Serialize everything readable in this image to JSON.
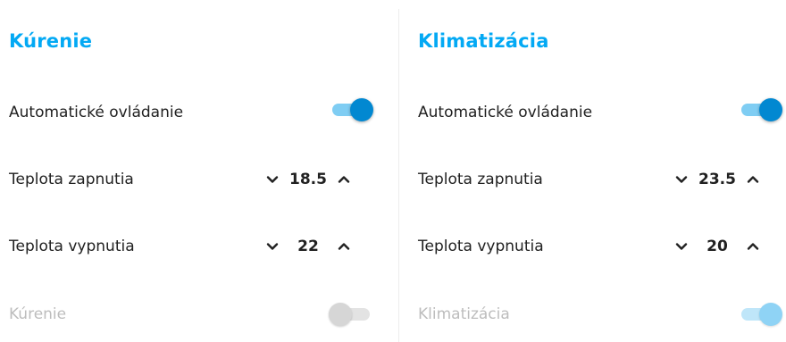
{
  "heating": {
    "title": "Kúrenie",
    "auto_label": "Automatické ovládanie",
    "auto_on": true,
    "on_temp_label": "Teplota zapnutia",
    "on_temp_value": "18.5",
    "off_temp_label": "Teplota vypnutia",
    "off_temp_value": "22",
    "status_label": "Kúrenie",
    "status_on": false
  },
  "cooling": {
    "title": "Klimatizácia",
    "auto_label": "Automatické ovládanie",
    "auto_on": true,
    "on_temp_label": "Teplota zapnutia",
    "on_temp_value": "23.5",
    "off_temp_label": "Teplota vypnutia",
    "off_temp_value": "20",
    "status_label": "Klimatizácia",
    "status_on": true
  },
  "icons": {
    "decrease": "chevron-down-icon",
    "increase": "chevron-up-icon"
  },
  "colors": {
    "accent": "#03a9f4",
    "toggle_on": "#0288d1",
    "text": "#212121",
    "disabled_text": "#bdbdbd"
  }
}
